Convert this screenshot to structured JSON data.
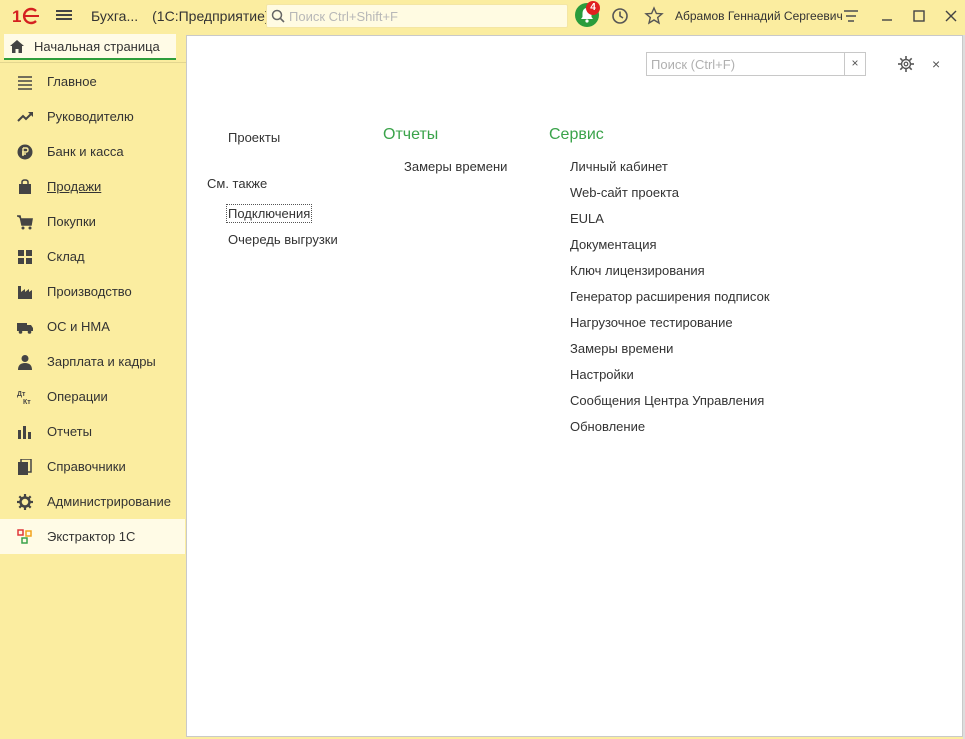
{
  "titlebar": {
    "app_name": "Бухга...",
    "app_platform": "(1С:Предприятие)",
    "search_placeholder": "Поиск Ctrl+Shift+F",
    "notification_count": "4",
    "user_name": "Абрамов Геннадий Сергеевич"
  },
  "tabs": {
    "home_label": "Начальная страница"
  },
  "sidebar": {
    "items": [
      {
        "label": "Главное",
        "icon": "menu-lines-icon"
      },
      {
        "label": "Руководителю",
        "icon": "trend-up-icon"
      },
      {
        "label": "Банк и касса",
        "icon": "ruble-coin-icon"
      },
      {
        "label": "Продажи",
        "icon": "shopping-bag-icon"
      },
      {
        "label": "Покупки",
        "icon": "shopping-cart-icon"
      },
      {
        "label": "Склад",
        "icon": "warehouse-grid-icon"
      },
      {
        "label": "Производство",
        "icon": "factory-icon"
      },
      {
        "label": "ОС и НМА",
        "icon": "truck-icon"
      },
      {
        "label": "Зарплата и кадры",
        "icon": "person-icon"
      },
      {
        "label": "Операции",
        "icon": "dt-kt-icon"
      },
      {
        "label": "Отчеты",
        "icon": "bar-chart-icon"
      },
      {
        "label": "Справочники",
        "icon": "books-icon"
      },
      {
        "label": "Администрирование",
        "icon": "gear-icon"
      },
      {
        "label": "Экстрактор 1С",
        "icon": "extractor-icon"
      }
    ],
    "dt_kt_glyph_top": "Дт",
    "dt_kt_glyph_bottom": "Кт"
  },
  "main": {
    "search_placeholder": "Поиск (Ctrl+F)",
    "clear_glyph": "×",
    "close_glyph": "×",
    "col1": {
      "projects": "Проекты",
      "see_also": "См. также",
      "connections": "Подключения",
      "upload_queue": "Очередь выгрузки"
    },
    "reports": {
      "title": "Отчеты",
      "items": [
        "Замеры времени"
      ]
    },
    "service": {
      "title": "Сервис",
      "items": [
        "Личный кабинет",
        "Web-сайт проекта",
        "EULA",
        "Документация",
        "Ключ лицензирования",
        "Генератор расширения подписок",
        "Нагрузочное тестирование",
        "Замеры времени",
        "Настройки",
        "Сообщения Центра Управления",
        "Обновление"
      ]
    }
  },
  "colors": {
    "sidebar_bg": "#fbeda0",
    "accent_green": "#3aa34a",
    "badge_red": "#e02020",
    "logo_red": "#d42020"
  }
}
